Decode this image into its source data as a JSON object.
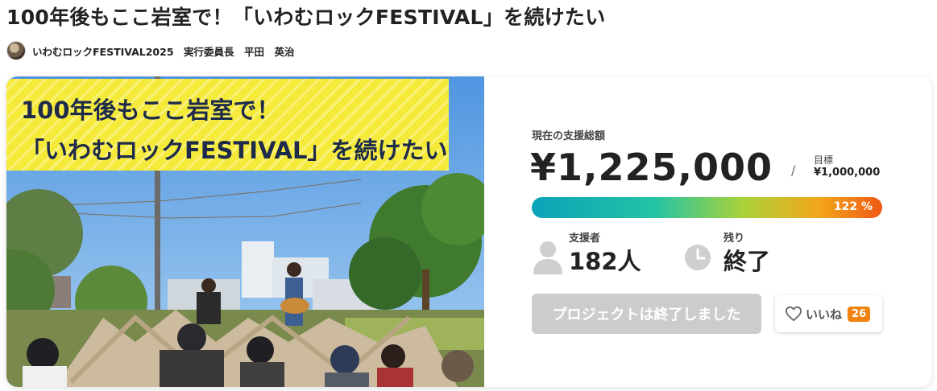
{
  "project": {
    "title": "100年後もここ岩室で！「いわむロックFESTIVAL」を続けたい",
    "owner": "いわむロックFESTIVAL2025　実行委員長　平田　英治"
  },
  "hero": {
    "banner_line1": "100年後もここ岩室で！",
    "banner_line2": "「いわむロックFESTIVAL」を続けたい"
  },
  "funding": {
    "raised_label": "現在の支援総額",
    "raised_amount": "¥1,225,000",
    "separator": "/",
    "goal_label": "目標",
    "goal_amount": "¥1,000,000",
    "percent": 122,
    "percent_text": "122 %",
    "supporters_label": "支援者",
    "supporters_value": "182人",
    "remaining_label": "残り",
    "remaining_value": "終了",
    "ended_button": "プロジェクトは終了しました",
    "like_label": "いいね",
    "like_count": "26"
  },
  "colors": {
    "banner_yellow": "#f5ea3a",
    "like_badge": "#f0820f",
    "progress_start": "#0aa3b8",
    "progress_end": "#f05a15"
  }
}
